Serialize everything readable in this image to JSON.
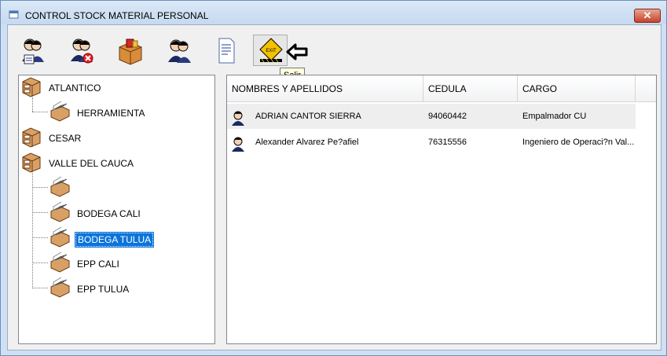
{
  "window": {
    "title": "CONTROL STOCK MATERIAL PERSONAL",
    "close_label": "✕"
  },
  "toolbar": {
    "buttons": [
      {
        "name": "add-person-button",
        "icon": "people-document-icon"
      },
      {
        "name": "delete-person-button",
        "icon": "people-delete-icon"
      },
      {
        "name": "stock-box-button",
        "icon": "box-icon"
      },
      {
        "name": "people-button",
        "icon": "people-icon"
      },
      {
        "name": "report-button",
        "icon": "document-icon"
      },
      {
        "name": "exit-button",
        "icon": "exit-sign-icon"
      }
    ],
    "tooltip": "Salir"
  },
  "tree": {
    "nodes": [
      {
        "label": "ATLANTICO",
        "level": 0,
        "icon": "cabinet-icon"
      },
      {
        "label": "HERRAMIENTA",
        "level": 1,
        "icon": "file-drawer-icon"
      },
      {
        "label": "CESAR",
        "level": 0,
        "icon": "cabinet-icon"
      },
      {
        "label": "VALLE DEL CAUCA",
        "level": 0,
        "icon": "cabinet-icon"
      },
      {
        "label": "",
        "level": 1,
        "icon": "file-drawer-icon"
      },
      {
        "label": "BODEGA CALI",
        "level": 1,
        "icon": "file-drawer-icon"
      },
      {
        "label": "BODEGA TULUA",
        "level": 1,
        "icon": "file-drawer-icon",
        "selected": true
      },
      {
        "label": "EPP CALI",
        "level": 1,
        "icon": "file-drawer-icon"
      },
      {
        "label": "EPP TULUA",
        "level": 1,
        "icon": "file-drawer-icon"
      }
    ]
  },
  "list": {
    "columns": [
      "NOMBRES Y APELLIDOS",
      "CEDULA",
      "CARGO"
    ],
    "rows": [
      {
        "name": "ADRIAN CANTOR SIERRA",
        "cedula": "94060442",
        "cargo": "Empalmador CU"
      },
      {
        "name": "Alexander Alvarez Pe?afiel",
        "cedula": "76315556",
        "cargo": "Ingeniero de Operaci?n Val..."
      }
    ]
  },
  "colors": {
    "selection": "#0a74da",
    "titlebar": "#c6d9ef",
    "close": "#c5432a"
  }
}
